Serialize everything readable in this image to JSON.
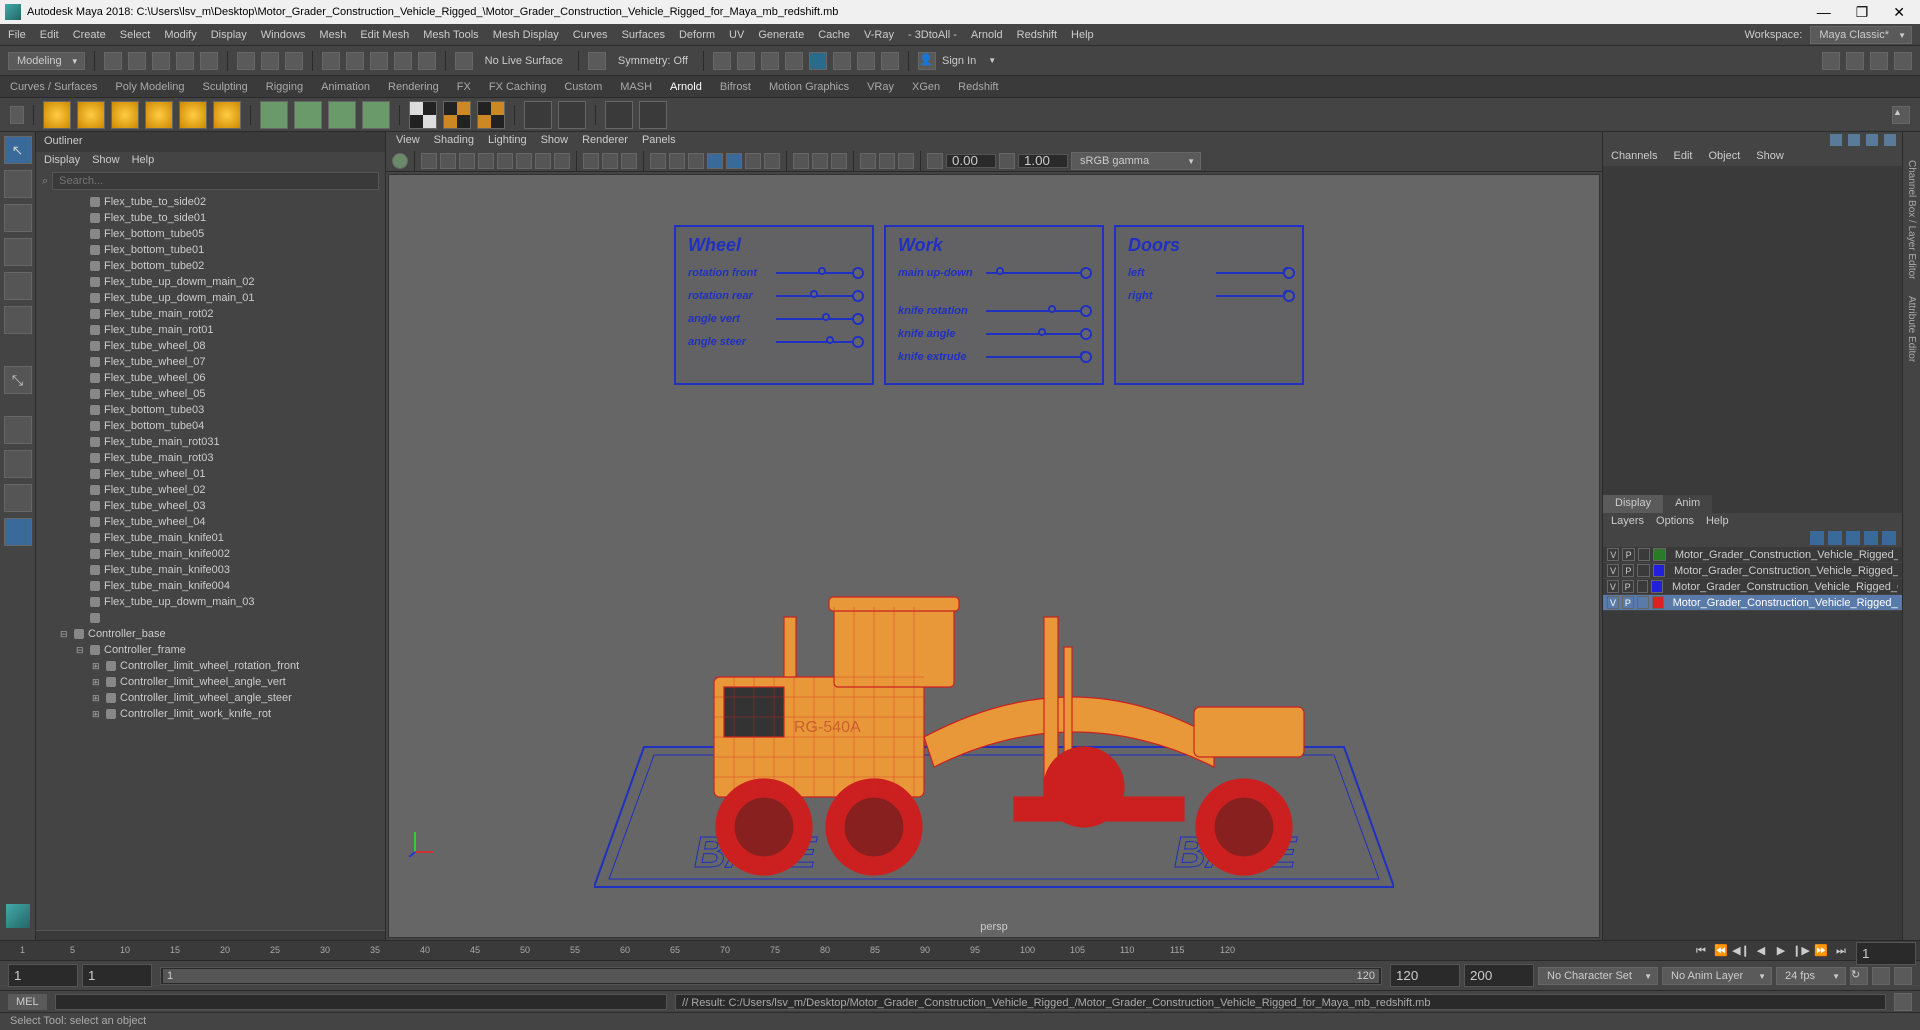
{
  "title": "Autodesk Maya 2018: C:\\Users\\lsv_m\\Desktop\\Motor_Grader_Construction_Vehicle_Rigged_\\Motor_Grader_Construction_Vehicle_Rigged_for_Maya_mb_redshift.mb",
  "workspace_label": "Workspace:",
  "workspace_value": "Maya Classic*",
  "menus": [
    "File",
    "Edit",
    "Create",
    "Select",
    "Modify",
    "Display",
    "Windows",
    "Mesh",
    "Edit Mesh",
    "Mesh Tools",
    "Mesh Display",
    "Curves",
    "Surfaces",
    "Deform",
    "UV",
    "Generate",
    "Cache",
    "V-Ray",
    "- 3DtoAll -",
    "Arnold",
    "Redshift",
    "Help"
  ],
  "mode_dropdown": "Modeling",
  "status": {
    "no_live_surface": "No Live Surface",
    "symmetry": "Symmetry: Off",
    "signin": "Sign In"
  },
  "shelf_tabs": [
    "Curves / Surfaces",
    "Poly Modeling",
    "Sculpting",
    "Rigging",
    "Animation",
    "Rendering",
    "FX",
    "FX Caching",
    "Custom",
    "MASH",
    "Arnold",
    "Bifrost",
    "Motion Graphics",
    "VRay",
    "XGen",
    "Redshift"
  ],
  "shelf_active": "Arnold",
  "outliner": {
    "title": "Outliner",
    "menus": [
      "Display",
      "Show",
      "Help"
    ],
    "search_placeholder": "Search...",
    "items": [
      "Flex_tube_to_side02",
      "Flex_tube_to_side01",
      "Flex_bottom_tube05",
      "Flex_bottom_tube01",
      "Flex_bottom_tube02",
      "Flex_tube_up_dowm_main_02",
      "Flex_tube_up_dowm_main_01",
      "Flex_tube_main_rot02",
      "Flex_tube_main_rot01",
      "Flex_tube_wheel_08",
      "Flex_tube_wheel_07",
      "Flex_tube_wheel_06",
      "Flex_tube_wheel_05",
      "Flex_bottom_tube03",
      "Flex_bottom_tube04",
      "Flex_tube_main_rot031",
      "Flex_tube_main_rot03",
      "Flex_tube_wheel_01",
      "Flex_tube_wheel_02",
      "Flex_tube_wheel_03",
      "Flex_tube_wheel_04",
      "Flex_tube_main_knife01",
      "Flex_tube_main_knife002",
      "Flex_tube_main_knife003",
      "Flex_tube_main_knife004",
      "Flex_tube_up_dowm_main_03"
    ],
    "controllers": {
      "base": "Controller_base",
      "frame": "Controller_frame",
      "children": [
        "Controller_limit_wheel_rotation_front",
        "Controller_limit_wheel_angle_vert",
        "Controller_limit_wheel_angle_steer",
        "Controller_limit_work_knife_rot"
      ]
    }
  },
  "viewport": {
    "menus": [
      "View",
      "Shading",
      "Lighting",
      "Show",
      "Renderer",
      "Panels"
    ],
    "val1": "0.00",
    "val2": "1.00",
    "colorspace": "sRGB gamma",
    "label": "persp",
    "rig_panels": {
      "wheel": {
        "title": "Wheel",
        "rows": [
          "rotation front",
          "rotation rear",
          "angle vert",
          "angle steer"
        ]
      },
      "work": {
        "title": "Work",
        "rows": [
          "main up-down",
          "",
          "knife rotation",
          "knife angle",
          "knife extrude"
        ]
      },
      "doors": {
        "title": "Doors",
        "rows": [
          "left",
          "right"
        ]
      }
    },
    "base_text": "BASE",
    "vehicle_label": "RG-540A"
  },
  "right": {
    "tabs": [
      "Channels",
      "Edit",
      "Object",
      "Show"
    ],
    "display_tabs": [
      "Display",
      "Anim"
    ],
    "layers_menus": [
      "Layers",
      "Options",
      "Help"
    ],
    "layers": [
      {
        "v": "V",
        "p": "P",
        "color": "#2a7a2a",
        "name": "Motor_Grader_Construction_Vehicle_Rigged_Bones",
        "sel": false
      },
      {
        "v": "V",
        "p": "P",
        "color": "#2020dd",
        "name": "Motor_Grader_Construction_Vehicle_Rigged_Helpers",
        "sel": false
      },
      {
        "v": "V",
        "p": "P",
        "color": "#2020dd",
        "name": "Motor_Grader_Construction_Vehicle_Rigged_Controllers",
        "sel": false
      },
      {
        "v": "V",
        "p": "P",
        "color": "#dd2020",
        "name": "Motor_Grader_Construction_Vehicle_Rigged_Geometry",
        "sel": true
      }
    ]
  },
  "timeline": {
    "ticks": [
      "1",
      "5",
      "10",
      "15",
      "20",
      "25",
      "30",
      "35",
      "40",
      "45",
      "50",
      "55",
      "60",
      "65",
      "70",
      "75",
      "80",
      "85",
      "90",
      "95",
      "100",
      "105",
      "110",
      "115",
      "120"
    ],
    "current_a": "1",
    "start": "1",
    "range_start": "1",
    "mid": "120",
    "range_end": "120",
    "end": "200",
    "charset": "No Character Set",
    "animlayer": "No Anim Layer",
    "fps": "24 fps"
  },
  "cmd": {
    "lang": "MEL",
    "result": "// Result: C:/Users/lsv_m/Desktop/Motor_Grader_Construction_Vehicle_Rigged_/Motor_Grader_Construction_Vehicle_Rigged_for_Maya_mb_redshift.mb"
  },
  "help_line": "Select Tool: select an object"
}
